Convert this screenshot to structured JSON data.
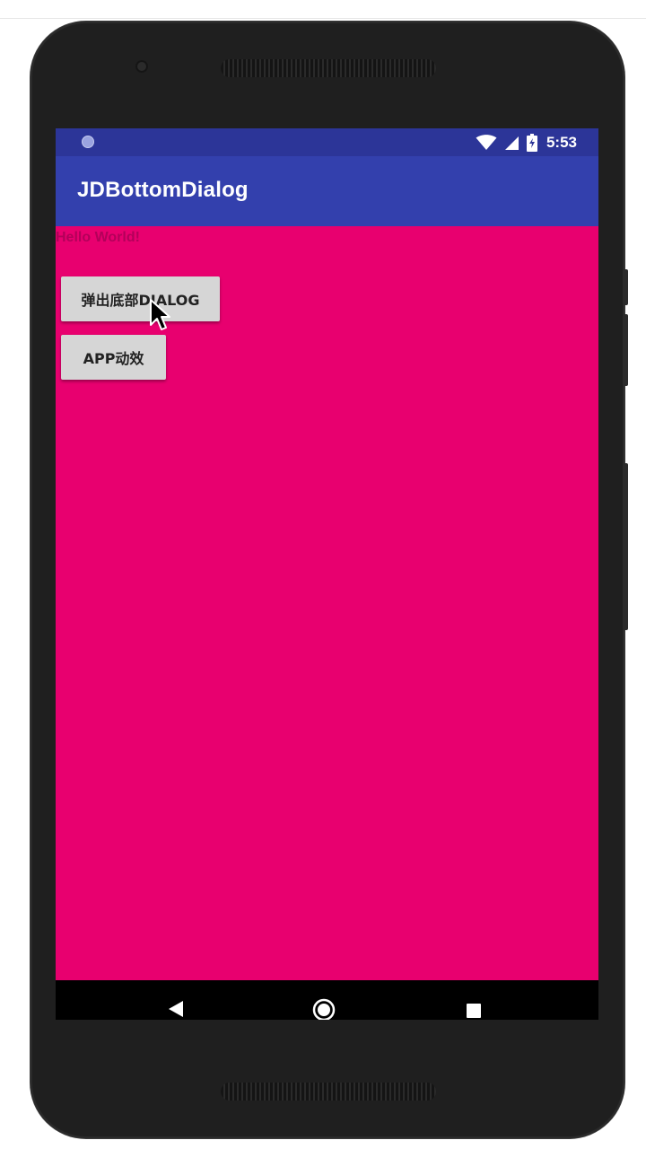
{
  "status_bar": {
    "time": "5:53",
    "icons": [
      "notification-dot-icon",
      "wifi-icon",
      "cell-signal-icon",
      "battery-icon"
    ]
  },
  "app_bar": {
    "title": "JDBottomDialog"
  },
  "content": {
    "hello_text": "Hello World!",
    "buttons": [
      {
        "label": "弹出底部DIALOG"
      },
      {
        "label": "APP动效"
      }
    ]
  },
  "nav_bar": {
    "icons": [
      "back-icon",
      "home-icon",
      "recents-icon"
    ]
  },
  "colors": {
    "status_bar": "#2c3598",
    "app_bar": "#3340ad",
    "background": "#e8006f",
    "button": "#d6d6d6",
    "nav_bar": "#000000"
  }
}
